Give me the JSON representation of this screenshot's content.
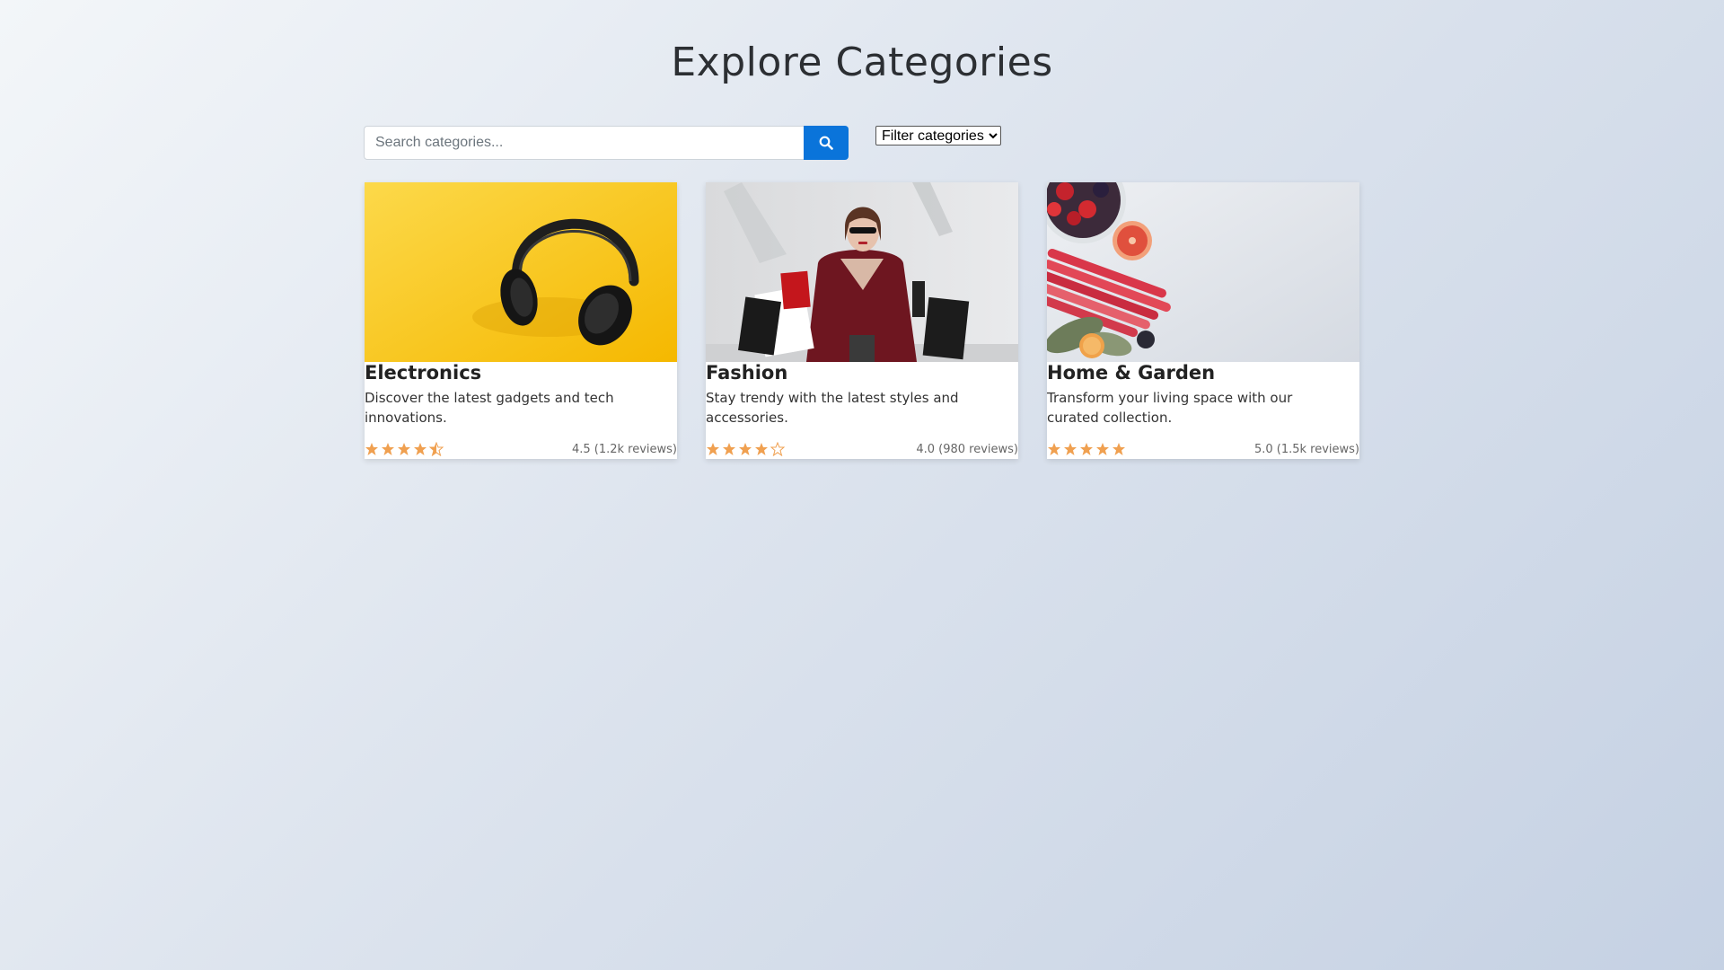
{
  "page": {
    "title": "Explore Categories"
  },
  "search": {
    "placeholder": "Search categories...",
    "value": ""
  },
  "filter": {
    "selected": "Filter categories"
  },
  "colors": {
    "accent": "#0a74da",
    "star": "#f0a050"
  },
  "categories": [
    {
      "title": "Electronics",
      "description": "Discover the latest gadgets and tech innovations.",
      "image": "headphones-photo",
      "rating": 4.5,
      "rating_text": "4.5 (1.2k reviews)"
    },
    {
      "title": "Fashion",
      "description": "Stay trendy with the latest styles and accessories.",
      "image": "shopping-woman-photo",
      "rating": 4.0,
      "rating_text": "4.0 (980 reviews)"
    },
    {
      "title": "Home & Garden",
      "description": "Transform your living space with our curated collection.",
      "image": "fruits-vegetables-photo",
      "rating": 5.0,
      "rating_text": "5.0 (1.5k reviews)"
    }
  ]
}
